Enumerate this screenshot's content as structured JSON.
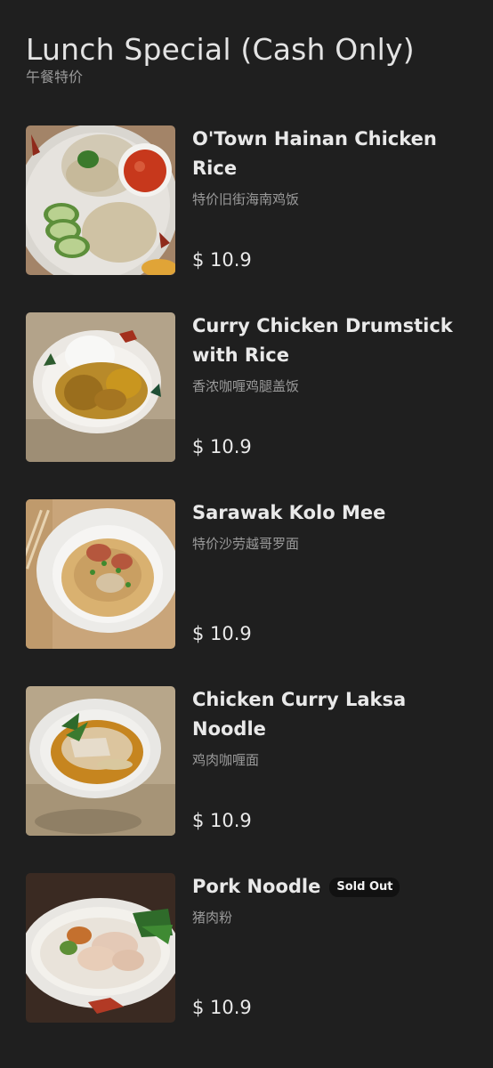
{
  "header": {
    "title": "Lunch Special (Cash Only)",
    "subtitle": "午餐特价"
  },
  "items": [
    {
      "name": "O'Town Hainan Chicken Rice",
      "name_cn": "特价旧街海南鸡饭",
      "price": "$ 10.9",
      "sold_out": ""
    },
    {
      "name": "Curry Chicken Drumstick with Rice",
      "name_cn": "香浓咖喱鸡腿盖饭",
      "price": "$ 10.9",
      "sold_out": ""
    },
    {
      "name": "Sarawak Kolo Mee",
      "name_cn": "特价沙劳越哥罗面",
      "price": "$ 10.9",
      "sold_out": ""
    },
    {
      "name": "Chicken Curry Laksa Noodle",
      "name_cn": "鸡肉咖喱面",
      "price": "$ 10.9",
      "sold_out": ""
    },
    {
      "name": "Pork Noodle",
      "name_cn": "猪肉粉",
      "price": "$ 10.9",
      "sold_out": "Sold Out"
    }
  ],
  "colors": {
    "background": "#1f1f1f",
    "text": "#e9e9e9",
    "muted": "#9a9a9a",
    "badge_bg": "#111111"
  }
}
